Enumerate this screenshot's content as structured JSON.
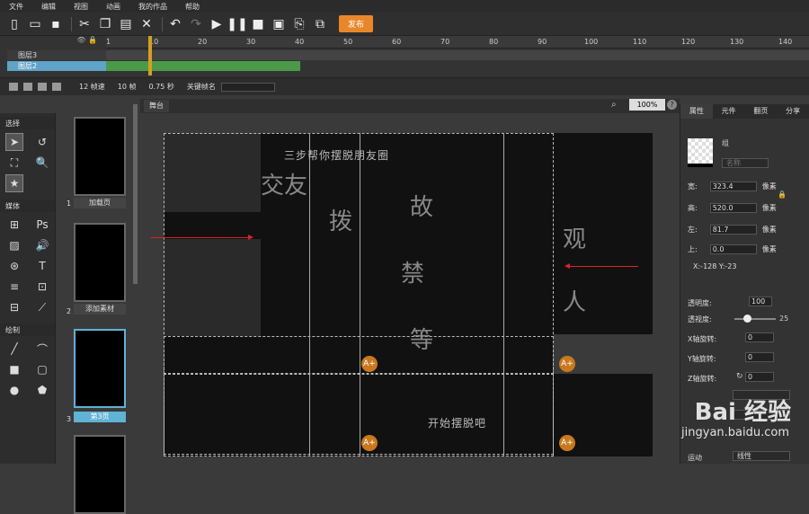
{
  "menu": [
    "文件",
    "编辑",
    "视图",
    "动画",
    "我的作品",
    "帮助"
  ],
  "toolbar": {
    "publish": "发布"
  },
  "timeline": {
    "ticks": [
      "1",
      "10",
      "20",
      "30",
      "40",
      "50",
      "60",
      "70",
      "80",
      "90",
      "100",
      "110",
      "120",
      "130",
      "140"
    ],
    "layers": [
      "图层3",
      "图层2"
    ]
  },
  "tlbar": {
    "fps": "12 帧速",
    "frames": "10 帧",
    "seconds": "0.75 秒",
    "keyframe_label": "关键帧名"
  },
  "toolbox": {
    "sections": [
      "选择",
      "媒体",
      "绘制"
    ]
  },
  "pages": [
    {
      "num": "1",
      "label": "加载页"
    },
    {
      "num": "2",
      "label": "添加素材"
    },
    {
      "num": "3",
      "label": "第3页"
    }
  ],
  "stage": {
    "tab": "舞台",
    "zoom": "100%",
    "title_text": "三步帮你摆脱朋友圈",
    "text_bottom": "开始摆脱吧",
    "add_label": "A+"
  },
  "props": {
    "tabs": [
      "属性",
      "元件",
      "翻页",
      "分享"
    ],
    "group": "组",
    "name_placeholder": "名称",
    "width_label": "宽:",
    "width": "323.4",
    "height_label": "高:",
    "height": "520.0",
    "left_label": "左:",
    "left": "81.7",
    "top_label": "上:",
    "top": "0.0",
    "unit": "像素",
    "coords": "X:-128  Y:-23",
    "opacity_label": "透明度:",
    "opacity": "100",
    "blur_label": "透视度:",
    "blur": "25",
    "xrot": "X轴旋转:",
    "xrot_v": "0",
    "yrot": "Y轴旋转:",
    "yrot_v": "0",
    "zrot": "Z轴旋转:",
    "zrot_v": "0",
    "motion_label": "运动",
    "motion_value": "线性"
  },
  "watermark": {
    "brand": "Bai 经验",
    "url": "jingyan.baidu.com"
  }
}
